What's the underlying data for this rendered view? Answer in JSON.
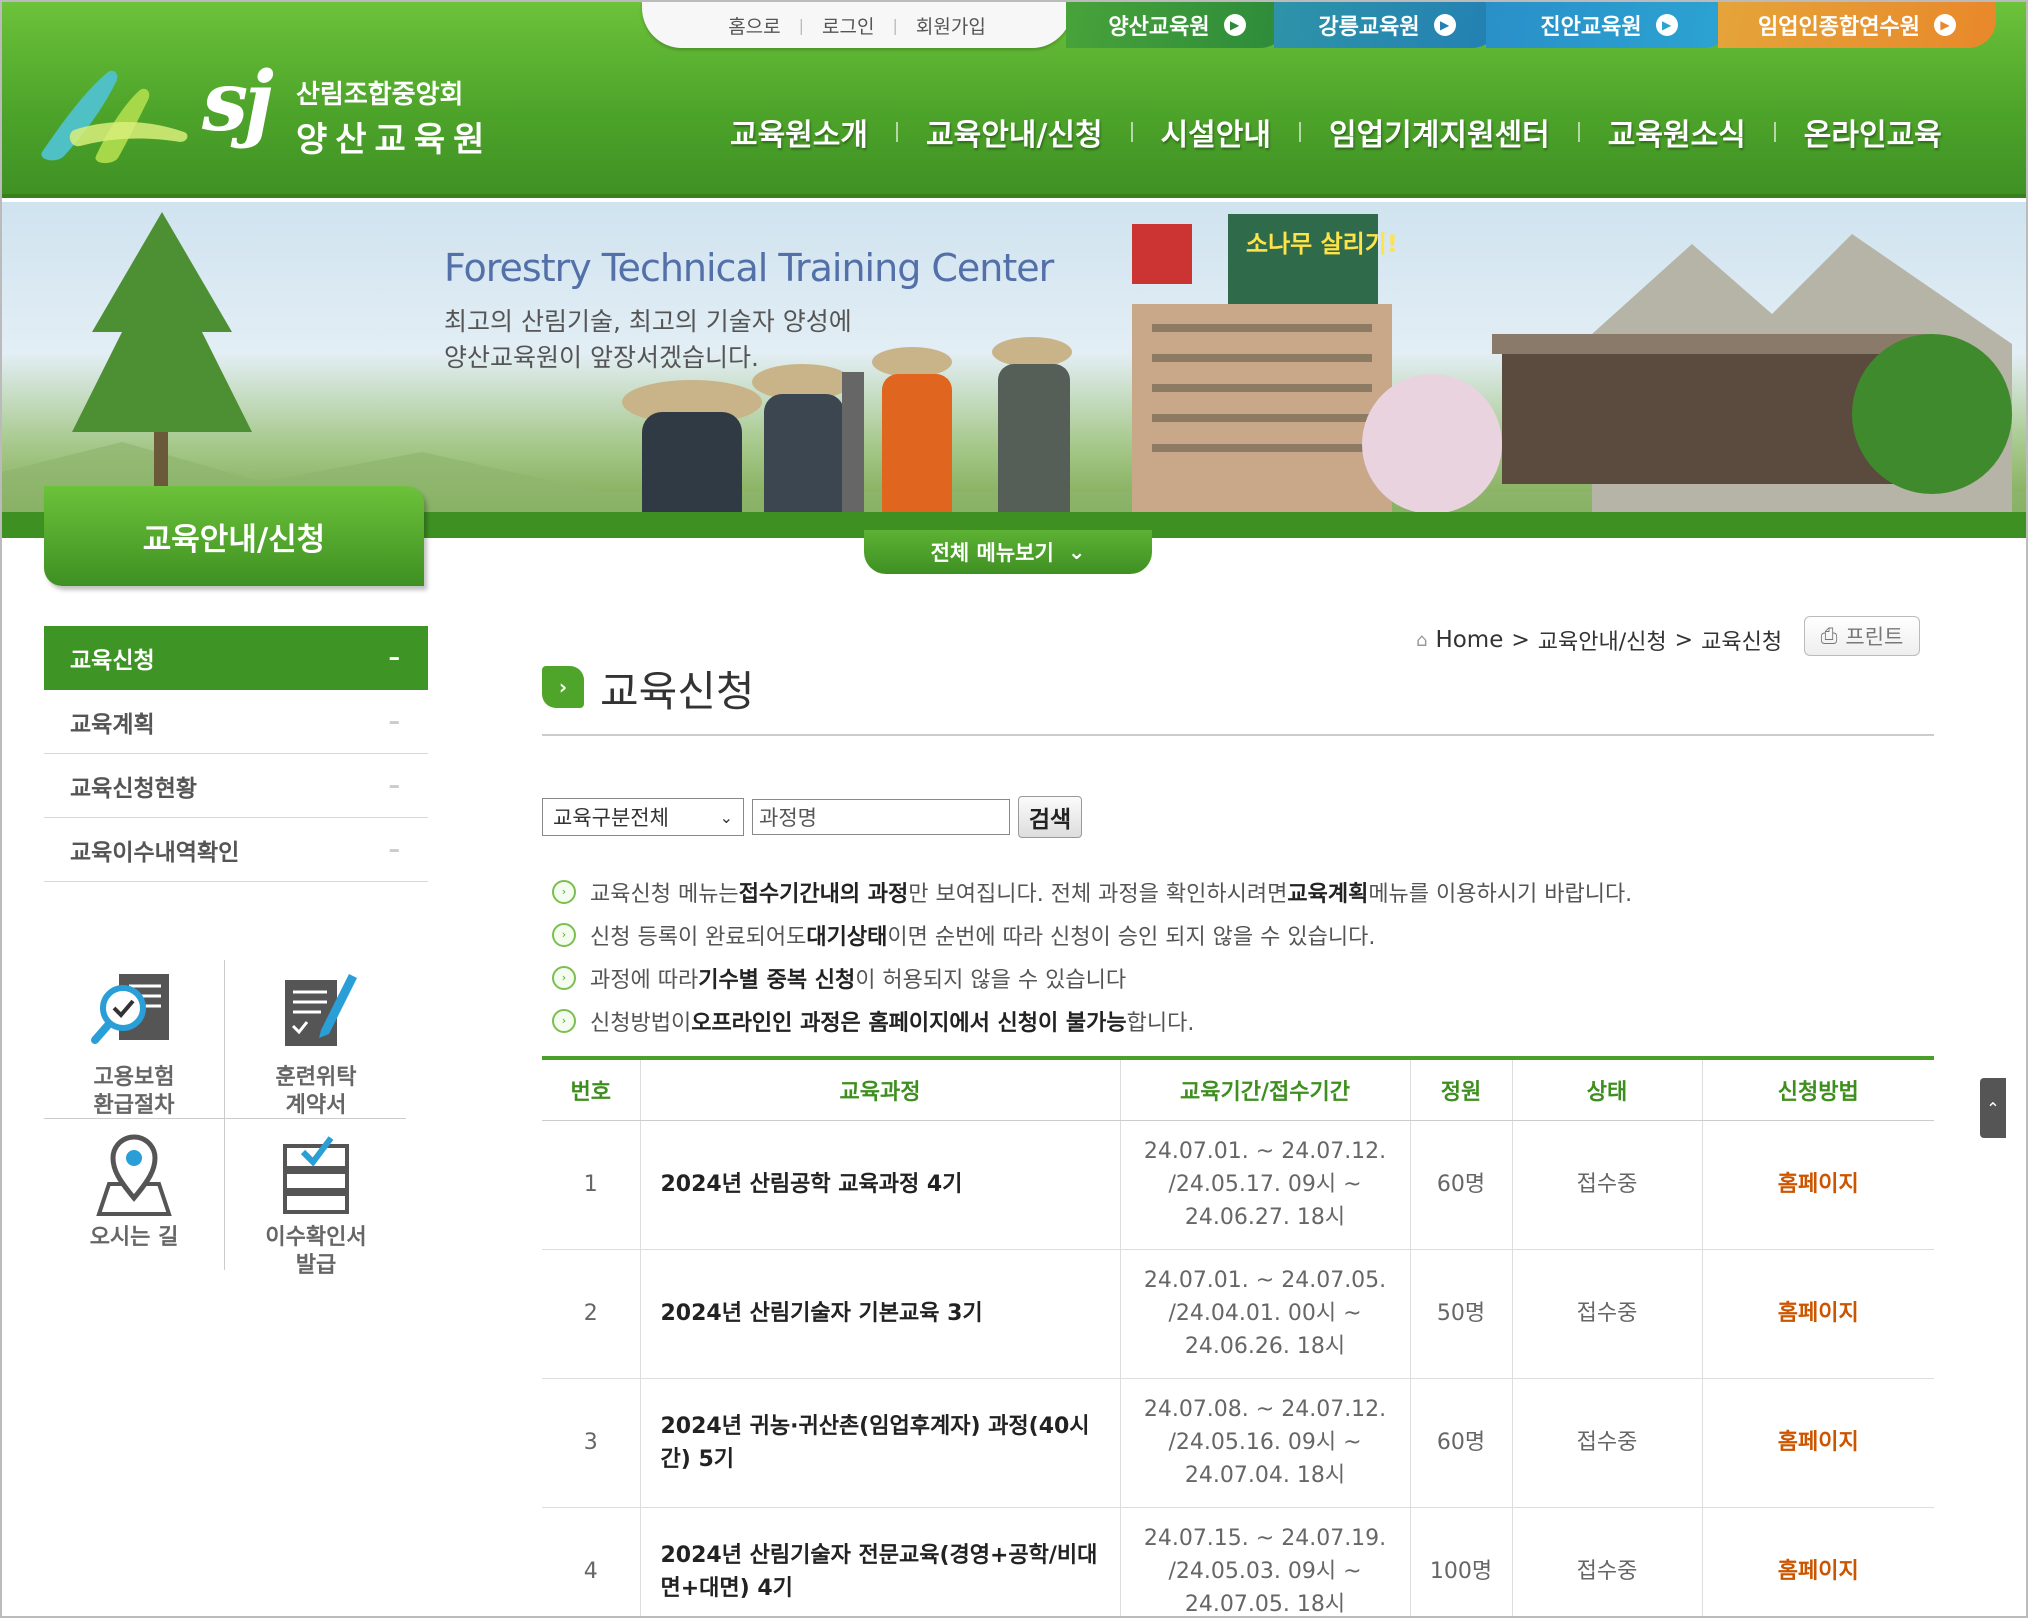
{
  "util_links": [
    "홈으로",
    "로그인",
    "회원가입"
  ],
  "site_tabs": [
    {
      "label": "양산교육원",
      "color": "#2f8f3c"
    },
    {
      "label": "강릉교육원",
      "color": "#2a86b8"
    },
    {
      "label": "진안교육원",
      "color": "#2c9fcf"
    },
    {
      "label": "임업인종합연수원",
      "color": "#e8902a"
    }
  ],
  "logo": {
    "mark": "sj",
    "line1": "산림조합중앙회",
    "line2": "양산교육원"
  },
  "gnb": [
    "교육원소개",
    "교육안내/신청",
    "시설안내",
    "임업기계지원센터",
    "교육원소식",
    "온라인교육"
  ],
  "banner": {
    "title_en": "Forestry Technical Training Center",
    "line1": "최고의 산림기술, 최고의 기술자 양성에",
    "line2": "양산교육원이 앞장서겠습니다.",
    "sign": "소나무 살리기!"
  },
  "all_menu": "전체 메뉴보기",
  "section_title": "교육안내/신청",
  "side_menu": [
    {
      "label": "교육신청",
      "active": true
    },
    {
      "label": "교육계획",
      "active": false
    },
    {
      "label": "교육신청현황",
      "active": false
    },
    {
      "label": "교육이수내역확인",
      "active": false
    }
  ],
  "quick_links": [
    {
      "line1": "고용보험",
      "line2": "환급절차",
      "icon": "magnifier-check-icon"
    },
    {
      "line1": "훈련위탁",
      "line2": "계약서",
      "icon": "document-pen-icon"
    },
    {
      "line1": "오시는 길",
      "line2": "",
      "icon": "map-pin-icon"
    },
    {
      "line1": "이수확인서",
      "line2": "발급",
      "icon": "certificate-stack-icon"
    }
  ],
  "breadcrumb": {
    "home": "Home",
    "sep": ">",
    "level1": "교육안내/신청",
    "level2": "교육신청"
  },
  "print_label": "프린트",
  "page_title": "교육신청",
  "search": {
    "category_value": "교육구분전체",
    "course_placeholder": "과정명",
    "button": "검색"
  },
  "notices": [
    {
      "parts": [
        {
          "t": "교육신청 메뉴는 "
        },
        {
          "t": "접수기간내의 과정",
          "b": true
        },
        {
          "t": "만 보여집니다. 전체 과정을 확인하시려면 "
        },
        {
          "t": "교육계획",
          "b": true
        },
        {
          "t": " 메뉴를 이용하시기 바랍니다."
        }
      ]
    },
    {
      "parts": [
        {
          "t": "신청 등록이 완료되어도 "
        },
        {
          "t": "대기상태",
          "b": true
        },
        {
          "t": "이면 순번에 따라 신청이 승인 되지 않을 수 있습니다."
        }
      ]
    },
    {
      "parts": [
        {
          "t": "과정에 따라 "
        },
        {
          "t": "기수별 중복 신청",
          "b": true
        },
        {
          "t": "이 허용되지 않을 수 있습니다"
        }
      ]
    },
    {
      "parts": [
        {
          "t": "신청방법이 "
        },
        {
          "t": "오프라인인 과정은 홈페이지에서 신청이 불가능",
          "b": true
        },
        {
          "t": "합니다."
        }
      ]
    }
  ],
  "table": {
    "headers": [
      "번호",
      "교육과정",
      "교육기간/접수기간",
      "정원",
      "상태",
      "신청방법"
    ],
    "rows": [
      {
        "no": "1",
        "course": "2024년 산림공학 교육과정 4기",
        "period": [
          "24.07.01. ~ 24.07.12.",
          "/24.05.17. 09시 ~",
          "24.06.27. 18시"
        ],
        "capacity": "60명",
        "status": "접수중",
        "method": "홈페이지"
      },
      {
        "no": "2",
        "course": "2024년 산림기술자 기본교육 3기",
        "period": [
          "24.07.01. ~ 24.07.05.",
          "/24.04.01. 00시 ~",
          "24.06.26. 18시"
        ],
        "capacity": "50명",
        "status": "접수중",
        "method": "홈페이지"
      },
      {
        "no": "3",
        "course": "2024년 귀농·귀산촌(임업후계자) 과정(40시간) 5기",
        "period": [
          "24.07.08. ~ 24.07.12.",
          "/24.05.16. 09시 ~",
          "24.07.04. 18시"
        ],
        "capacity": "60명",
        "status": "접수중",
        "method": "홈페이지"
      },
      {
        "no": "4",
        "course": "2024년 산림기술자 전문교육(경영+공학/비대면+대면) 4기",
        "period": [
          "24.07.15. ~ 24.07.19.",
          "/24.05.03. 09시 ~",
          "24.07.05. 18시"
        ],
        "capacity": "100명",
        "status": "접수중",
        "method": "홈페이지"
      }
    ]
  }
}
